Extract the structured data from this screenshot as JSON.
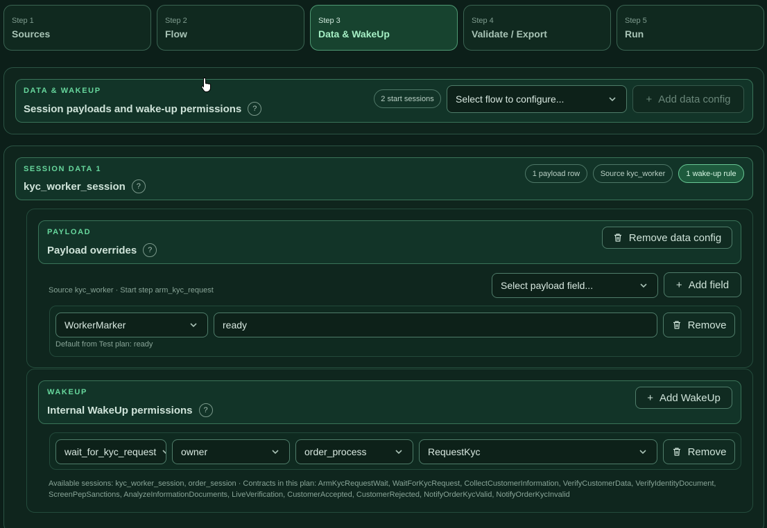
{
  "steps": [
    {
      "num": "Step 1",
      "title": "Sources"
    },
    {
      "num": "Step 2",
      "title": "Flow"
    },
    {
      "num": "Step 3",
      "title": "Data & WakeUp"
    },
    {
      "num": "Step 4",
      "title": "Validate / Export"
    },
    {
      "num": "Step 5",
      "title": "Run"
    }
  ],
  "data_wakeup": {
    "eyebrow": "DATA & WAKEUP",
    "title": "Session payloads and wake-up permissions",
    "sessions_pill": "2 start sessions",
    "flow_select": "Select flow to configure...",
    "add_data_config": "Add data config"
  },
  "session": {
    "eyebrow": "SESSION DATA 1",
    "title": "kyc_worker_session",
    "pills": [
      "1 payload row",
      "Source kyc_worker",
      "1 wake-up rule"
    ]
  },
  "payload": {
    "eyebrow": "PAYLOAD",
    "title": "Payload overrides",
    "remove_config": "Remove data config",
    "source_info": "Source kyc_worker · Start step arm_kyc_request",
    "field_select": "Select payload field...",
    "add_field": "Add field",
    "row": {
      "field": "WorkerMarker",
      "value": "ready",
      "remove": "Remove",
      "hint": "Default from Test plan: ready"
    }
  },
  "wakeup": {
    "eyebrow": "WAKEUP",
    "title": "Internal WakeUp permissions",
    "add_wakeup": "Add WakeUp",
    "row": {
      "session": "wait_for_kyc_request",
      "role": "owner",
      "target": "order_process",
      "contract": "RequestKyc",
      "remove": "Remove"
    },
    "footer_line1": "Available sessions: kyc_worker_session, order_session · Contracts in this plan: ArmKycRequestWait, WaitForKycRequest, CollectCustomerInformation, VerifyCustomerData, VerifyIdentityDocument,",
    "footer_line2": "ScreenPepSanctions, AnalyzeInformationDocuments, LiveVerification, CustomerAccepted, CustomerRejected, NotifyOrderKycValid, NotifyOrderKycInvalid"
  },
  "icons": {
    "help": "?",
    "plus": "+"
  },
  "colors": {
    "background": "#0c1f19",
    "accent": "#67d79d",
    "active_step": "#17432f"
  }
}
